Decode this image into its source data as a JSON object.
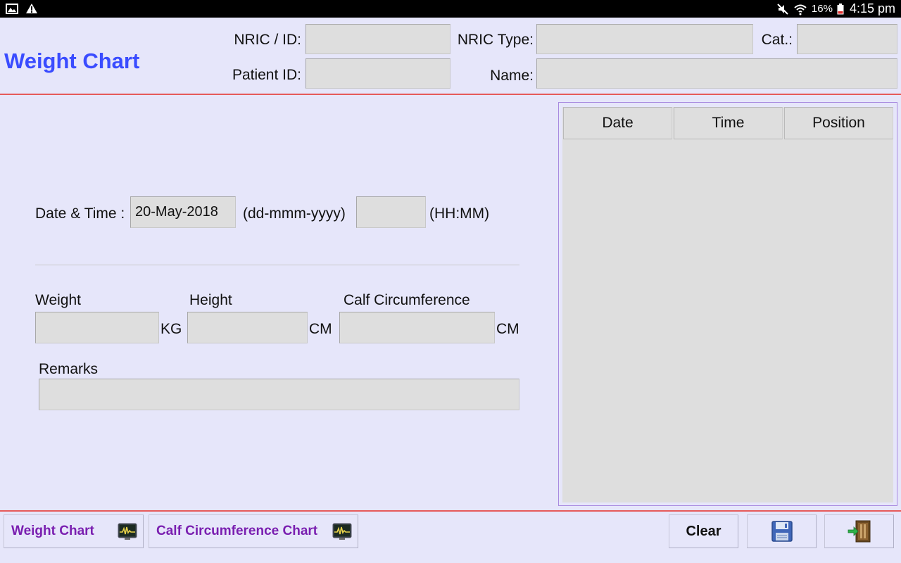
{
  "status_bar": {
    "battery": "16%",
    "time": "4:15 pm",
    "icons": [
      "image-icon",
      "warning-icon",
      "mute-icon",
      "wifi-icon",
      "battery-icon"
    ]
  },
  "header": {
    "title": "Weight Chart",
    "nric_label": "NRIC / ID:",
    "nric_value": "",
    "nric_type_label": "NRIC Type:",
    "nric_type_value": "",
    "cat_label": "Cat.:",
    "cat_value": "",
    "patient_id_label": "Patient ID:",
    "patient_id_value": "",
    "name_label": "Name:",
    "name_value": ""
  },
  "form": {
    "datetime_label": "Date & Time :",
    "date_value": "20-May-2018",
    "date_format": "(dd-mmm-yyyy)",
    "time_value": "",
    "time_format": "(HH:MM)",
    "weight_label": "Weight",
    "weight_value": "",
    "weight_unit": "KG",
    "height_label": "Height",
    "height_value": "",
    "height_unit": "CM",
    "calf_label": "Calf Circumference",
    "calf_value": "",
    "calf_unit": "CM",
    "remarks_label": "Remarks",
    "remarks_value": ""
  },
  "list": {
    "columns": [
      "Date",
      "Time",
      "Position"
    ],
    "rows": []
  },
  "bottom": {
    "weight_chart_label": "Weight Chart",
    "calf_chart_label": "Calf Circumference Chart",
    "clear_label": "Clear",
    "save_icon": "save-icon",
    "exit_icon": "exit-door-icon"
  },
  "colors": {
    "background": "#e6e6fa",
    "title_blue": "#3a4cff",
    "tab_purple": "#7a1fb0",
    "separator_red": "#e65a5a",
    "field_gray": "#dedede"
  }
}
